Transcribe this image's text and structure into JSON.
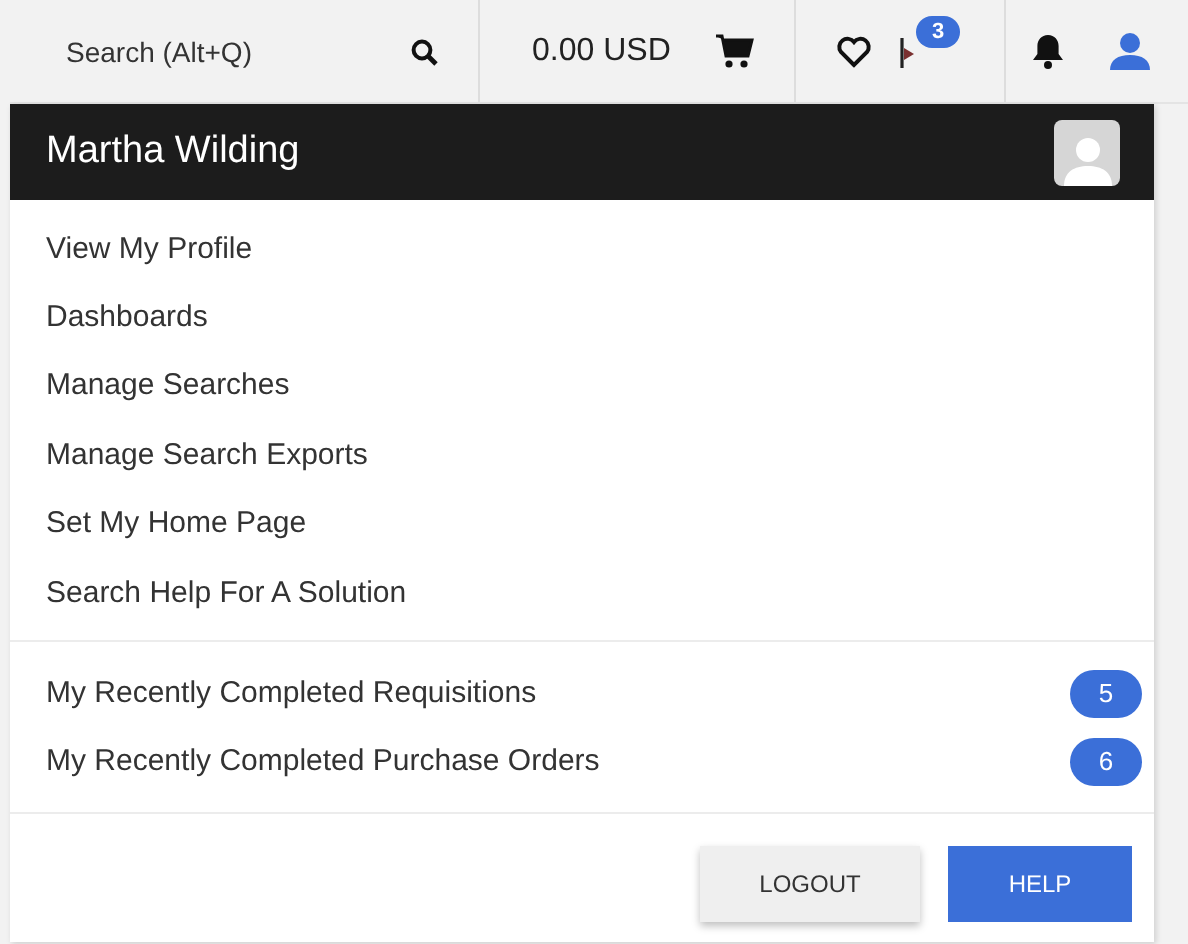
{
  "top_bar": {
    "search": {
      "placeholder": "Search (Alt+Q)"
    },
    "cart_total": "0.00 USD",
    "flag_badge": "3"
  },
  "user_menu": {
    "user_name": "Martha Wilding",
    "links": [
      {
        "label": "View My Profile"
      },
      {
        "label": "Dashboards"
      },
      {
        "label": "Manage Searches"
      },
      {
        "label": "Manage Search Exports"
      },
      {
        "label": "Set My Home Page"
      },
      {
        "label": "Search Help For A Solution"
      }
    ],
    "recent": [
      {
        "label": "My Recently Completed Requisitions",
        "count": "5"
      },
      {
        "label": "My Recently Completed Purchase Orders",
        "count": "6"
      }
    ],
    "buttons": [
      {
        "label": "LOGOUT",
        "kind": "secondary"
      },
      {
        "label": "HELP",
        "kind": "primary"
      }
    ]
  }
}
